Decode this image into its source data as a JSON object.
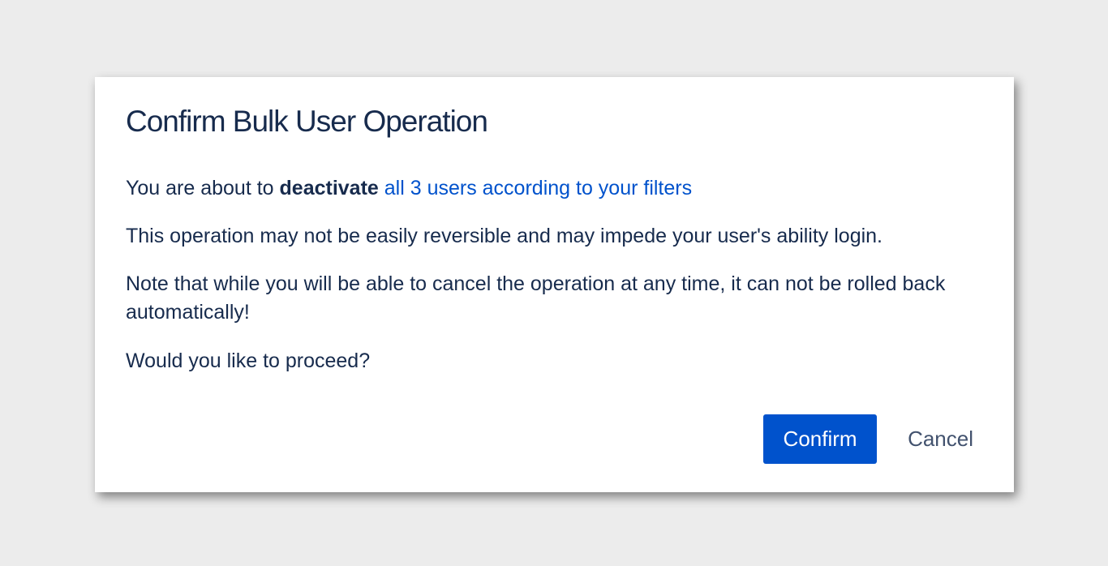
{
  "dialog": {
    "title": "Confirm Bulk User Operation",
    "intro_prefix": "You are about to ",
    "action": "deactivate",
    "target_link": "all 3 users according to your filters",
    "warning": "This operation may not be easily reversible and may impede your user's ability login.",
    "note": "Note that while you will be able to cancel the operation at any time, it can not be rolled back automatically!",
    "question": "Would you like to proceed?",
    "confirm_label": "Confirm",
    "cancel_label": "Cancel"
  },
  "colors": {
    "background": "#ececec",
    "dialog": "#ffffff",
    "text": "#172b4d",
    "link": "#0052cc",
    "primary_button": "#0052cc",
    "subtle_button_text": "#42526e"
  }
}
